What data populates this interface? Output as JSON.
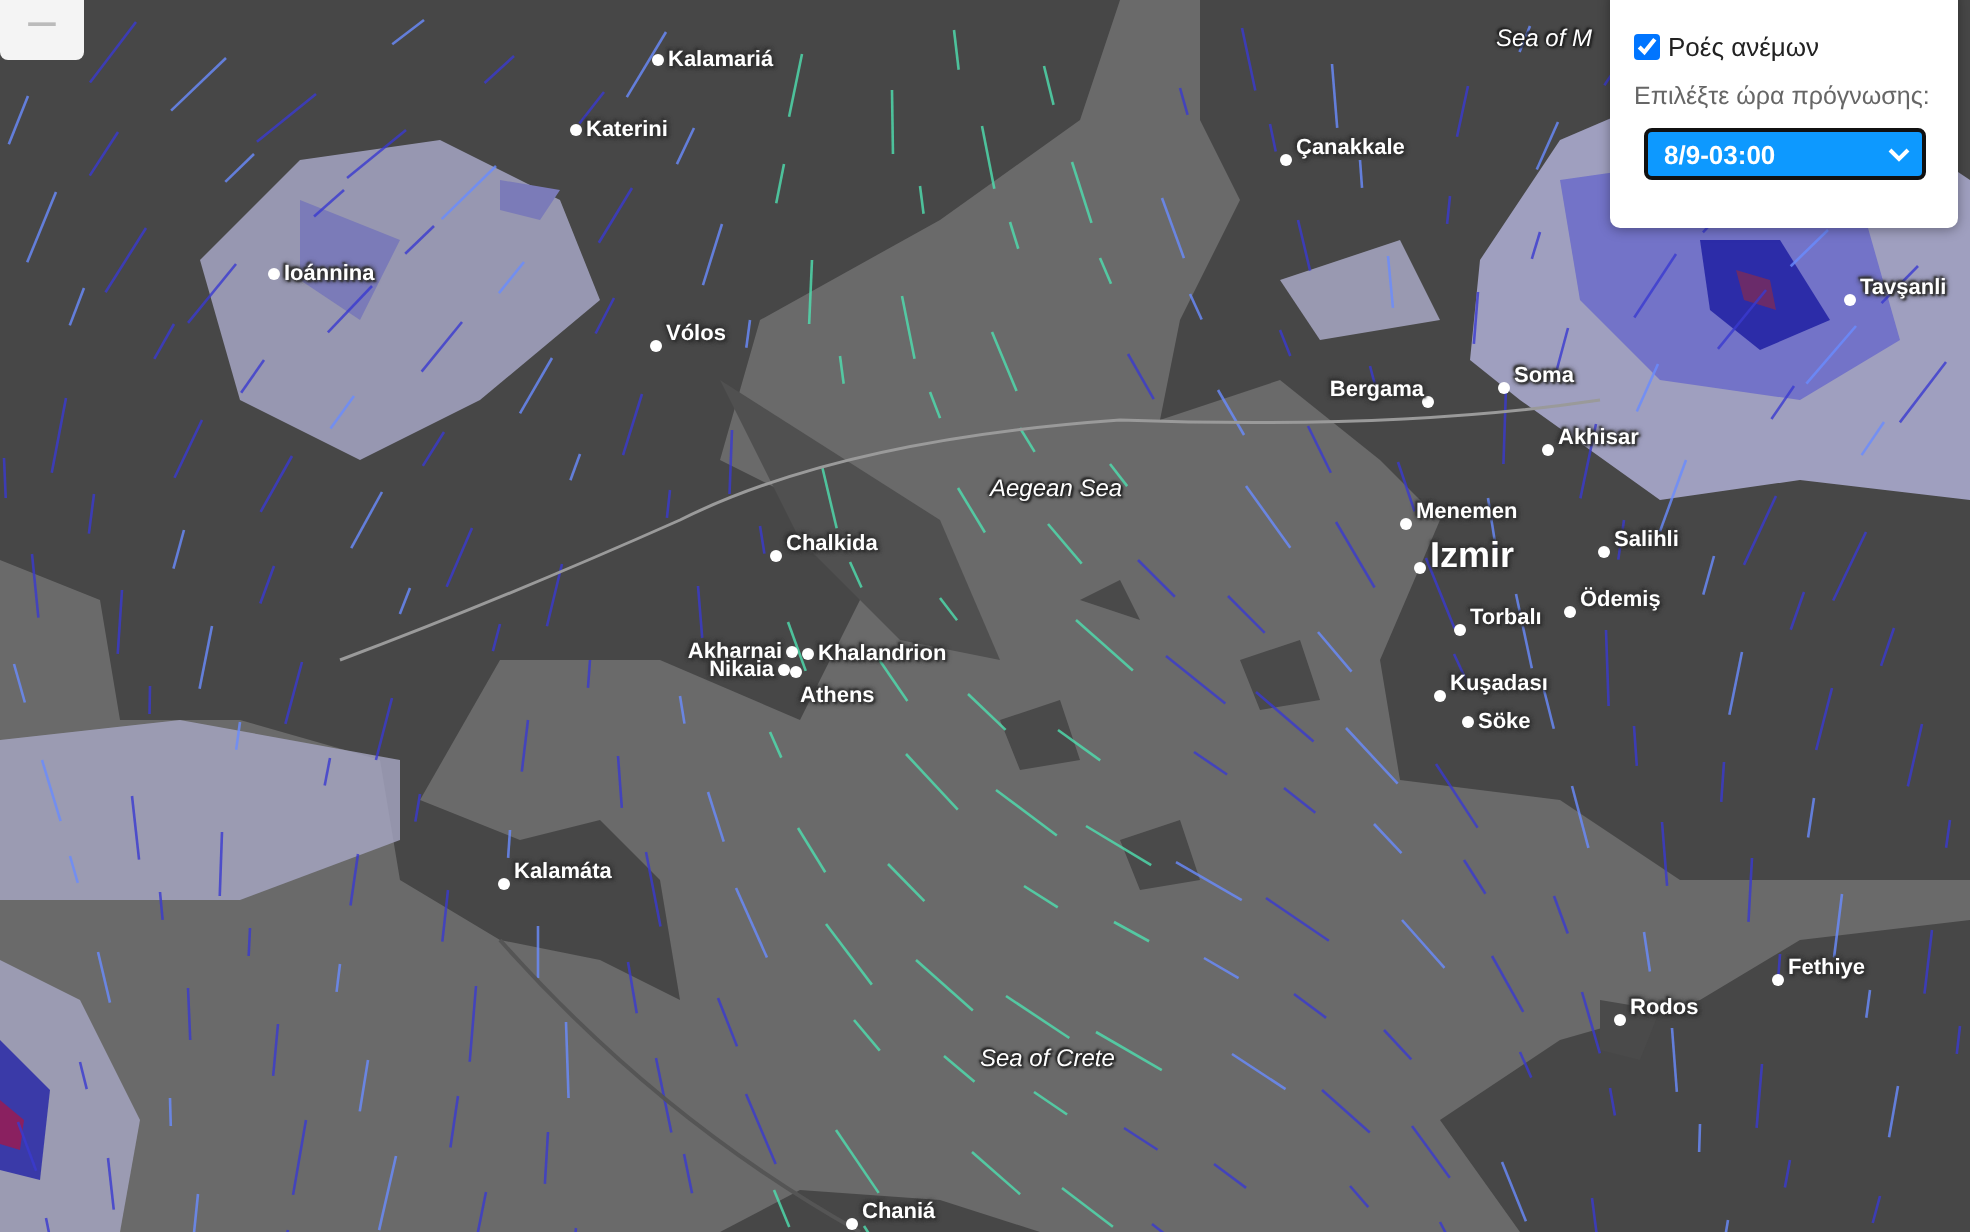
{
  "zoom_control": {
    "label": "−"
  },
  "map": {
    "cities": [
      {
        "name": "Kalamariá",
        "major": false
      },
      {
        "name": "Katerini",
        "major": false
      },
      {
        "name": "Ioánnina",
        "major": false
      },
      {
        "name": "Vólos",
        "major": false
      },
      {
        "name": "Chalkida",
        "major": false
      },
      {
        "name": "Akharnai",
        "major": false
      },
      {
        "name": "Khalandrion",
        "major": false
      },
      {
        "name": "Nikaia",
        "major": false
      },
      {
        "name": "Athens",
        "major": false
      },
      {
        "name": "Kalamáta",
        "major": false
      },
      {
        "name": "Chaniá",
        "major": false
      },
      {
        "name": "Çanakkale",
        "major": false
      },
      {
        "name": "Bergama",
        "major": false
      },
      {
        "name": "Soma",
        "major": false
      },
      {
        "name": "Akhisar",
        "major": false
      },
      {
        "name": "Tavşanli",
        "major": false
      },
      {
        "name": "Menemen",
        "major": false
      },
      {
        "name": "Izmir",
        "major": true
      },
      {
        "name": "Salihli",
        "major": false
      },
      {
        "name": "Torbalı",
        "major": false
      },
      {
        "name": "Ödemiş",
        "major": false
      },
      {
        "name": "Kuşadası",
        "major": false
      },
      {
        "name": "Söke",
        "major": false
      },
      {
        "name": "Fethiye",
        "major": false
      },
      {
        "name": "Rodos",
        "major": false
      }
    ],
    "seas": [
      {
        "name": "Sea of M"
      },
      {
        "name": "Aegean Sea"
      },
      {
        "name": "Sea of Crete"
      }
    ]
  },
  "panel": {
    "wind_flows": {
      "label": "Ροές ανέμων",
      "checked": true
    },
    "forecast_time": {
      "label": "Επιλέξτε ώρα πρόγνωσης:",
      "value": "8/9-03:00"
    }
  }
}
